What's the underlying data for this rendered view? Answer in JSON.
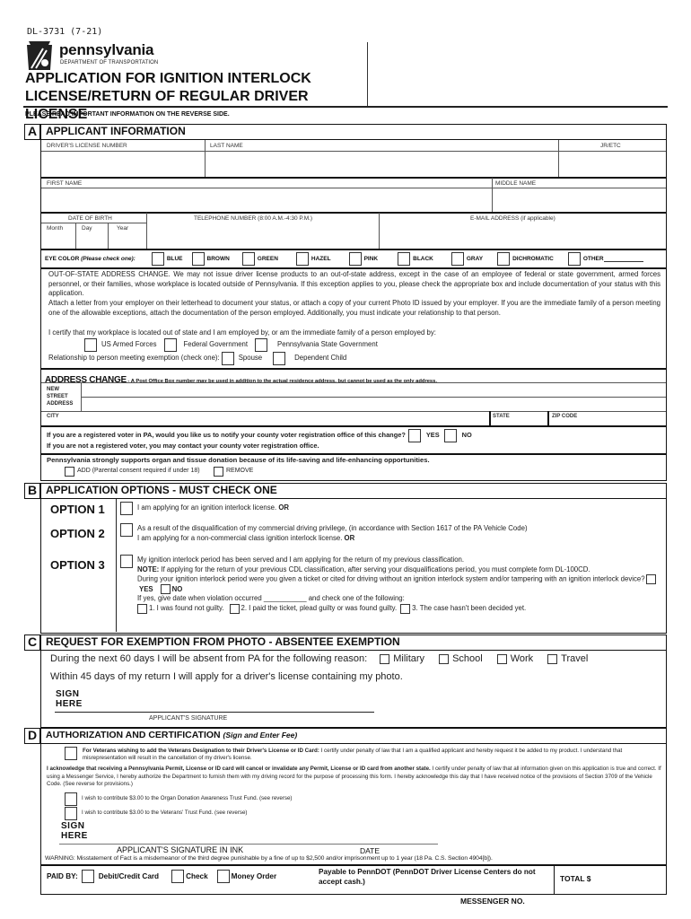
{
  "form_code": "DL-3731 (7-21)",
  "logo": {
    "name": "pennsylvania",
    "subtitle": "DEPARTMENT OF TRANSPORTATION"
  },
  "title_line1": "APPLICATION FOR IGNITION INTERLOCK",
  "title_line2": "LICENSE/RETURN OF REGULAR DRIVER LICENSE",
  "read_note": "PLEASE READ IMPORTANT INFORMATION ON THE REVERSE SIDE.",
  "section_a": {
    "letter": "A",
    "title": "APPLICANT INFORMATION",
    "fields": {
      "dl_number": "DRIVER'S LICENSE NUMBER",
      "last_name": "LAST NAME",
      "jr_etc": "JR/ETC",
      "first_name": "FIRST NAME",
      "middle_name": "MIDDLE NAME",
      "dob": "DATE OF BIRTH",
      "month": "Month",
      "day": "Day",
      "year": "Year",
      "telephone": "TELEPHONE NUMBER (8:00 A.M.-4:30 P.M.)",
      "email": "E-MAIL ADDRESS (if applicable)"
    },
    "eye_color": {
      "label": "EYE COLOR",
      "hint": "(Please check one):",
      "options": [
        "BLUE",
        "BROWN",
        "GREEN",
        "HAZEL",
        "PINK",
        "BLACK",
        "GRAY",
        "DICHROMATIC",
        "OTHER"
      ]
    },
    "out_of_state": {
      "p1": "OUT-OF-STATE ADDRESS CHANGE. We may not issue driver license products to an out-of-state address, except in the case of an employee of federal or state government, armed forces personnel, or their families, whose workplace is located outside of Pennsylvania. If this exception applies to you, please check the appropriate box and include documentation of your status with this application.",
      "p2": "Attach a letter from your employer on their letterhead to document your status, or attach a copy of your current Photo ID issued by your employer. If you are the immediate family of a person meeting one of the allowable exceptions, attach the documentation of the person employed. Additionally, you must indicate your relationship to that person.",
      "certify": "I certify that my workplace is located out of state and I am employed by, or am the immediate family of a person employed by:",
      "employers": [
        "US Armed Forces",
        "Federal Government",
        "Pennsylvania State Government"
      ],
      "relationship_label": "Relationship to person meeting exemption (check one):",
      "relationships": [
        "Spouse",
        "Dependent Child"
      ]
    },
    "address_change": {
      "title": "ADDRESS CHANGE",
      "note": " - A Post Office Box number may be used in addition to the actual residence address, but cannot be used as the only address.",
      "street_label": "NEW STREET ADDRESS",
      "city": "CITY",
      "state": "STATE",
      "zip": "ZIP CODE"
    },
    "voter": {
      "q1": "If you are a registered voter in PA, would you like us to notify your county voter registration office of this change?",
      "yes": "YES",
      "no": "NO",
      "q2": "If you are not a registered voter, you may contact your county voter registration office."
    },
    "organ": {
      "text": "Pennsylvania strongly supports organ and tissue donation because of its life-saving and life-enhancing opportunities.",
      "add": "ADD (Parental consent required if under 18)",
      "remove": "REMOVE"
    }
  },
  "section_b": {
    "letter": "B",
    "title": "APPLICATION OPTIONS - MUST CHECK ONE",
    "option1": {
      "label": "OPTION 1",
      "text": "I am applying for an ignition interlock license. ",
      "or": "OR"
    },
    "option2": {
      "label": "OPTION 2",
      "line1": "As a result of the disqualification of my commercial driving privilege, (in accordance with Section 1617 of the PA Vehicle Code)",
      "line2": "I am applying for a non-commercial class ignition interlock license. ",
      "or": "OR"
    },
    "option3": {
      "label": "OPTION 3",
      "line1": "My ignition interlock period has been served and I am applying for the return of my previous classification.",
      "note_label": "NOTE:",
      "note": " If applying for the return of your previous CDL classification, after serving your disqualifications period, you must complete form DL-100CD.",
      "q": "During your ignition interlock period were you given a ticket or cited for driving without an ignition interlock system and/or tampering with an ignition interlock device?",
      "yes": "YES",
      "no": "NO",
      "date_line": "If yes, give date when violation occurred ___________ and check one of the following:",
      "outcomes": [
        "1. I was found not guilty.",
        "2. I paid the ticket, plead guilty or was found guilty.",
        "3. The case hasn't been decided yet."
      ]
    }
  },
  "section_c": {
    "letter": "C",
    "title": "REQUEST FOR EXEMPTION FROM PHOTO - ABSENTEE EXEMPTION",
    "absent_text": "During the next 60 days I will be absent from PA for the following reason:",
    "reasons": [
      "Military",
      "School",
      "Work",
      "Travel"
    ],
    "return_text": "Within 45 days of my return I will apply for a driver's license containing my photo.",
    "sign_here": [
      "SIGN",
      "HERE"
    ],
    "signature_label": "APPLICANT'S SIGNATURE"
  },
  "section_d": {
    "letter": "D",
    "title": "AUTHORIZATION AND CERTIFICATION",
    "title_note": "(Sign and Enter Fee)",
    "veterans_bold": "For Veterans wishing to add the Veterans Designation to their Driver's License or ID Card:",
    "veterans_text": " I certify under penalty of law that I am a qualified applicant and hereby request it be added to my product.  I understand that misrepresentation will result in the cancellation of my driver's license.",
    "ack_bold": "I acknowledge that receiving a Pennsylvania Permit, License or ID card will cancel or invalidate any Permit, License or ID card from another state.",
    "ack_text": " I certify under penalty of law that all information given on this application is true and correct. If using a Messenger Service, I hereby authorize the Department to furnish them with my driving record for the purpose of processing this form. I hereby acknowledge this day that I have received notice of the provisions of Section 3709 of the Vehicle Code. (See reverse for provisions.)",
    "contrib_organ": "I wish to contribute $3.00 to the Organ Donation Awareness Trust Fund. (see reverse)",
    "contrib_veterans": "I wish to contribute $3.00 to the Veterans' Trust Fund. (see reverse)",
    "sign_here": [
      "SIGN",
      "HERE"
    ],
    "signature_label": "APPLICANT'S SIGNATURE IN INK",
    "date_label": "DATE",
    "warning": "WARNING: Misstatement of Fact is a misdemeanor of the third degree punishable by a fine of up to $2,500 and/or imprisonment up to 1 year (18 Pa. C.S. Section 4904[b]).",
    "paid_by": "PAID BY:",
    "payment_methods": [
      "Debit/Credit Card",
      "Check",
      "Money Order"
    ],
    "payable": "Payable to PennDOT (PennDOT Driver License Centers do not accept cash.)",
    "total": "TOTAL  $",
    "messenger": "MESSENGER NO."
  }
}
